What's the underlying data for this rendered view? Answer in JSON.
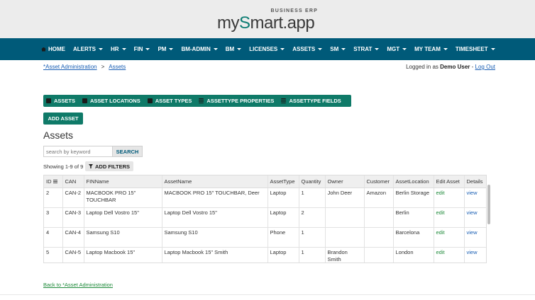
{
  "brand": {
    "main_prefix": "my",
    "main_dot": "S",
    "main_suffix": "mart.app",
    "sub": "BUSINESS ERP"
  },
  "nav": [
    {
      "label": "HOME",
      "has_caret": false
    },
    {
      "label": "ALERTS",
      "has_caret": true
    },
    {
      "label": "HR",
      "has_caret": true
    },
    {
      "label": "FIN",
      "has_caret": true
    },
    {
      "label": "PM",
      "has_caret": true
    },
    {
      "label": "BM-ADMIN",
      "has_caret": true
    },
    {
      "label": "BM",
      "has_caret": true
    },
    {
      "label": "LICENSES",
      "has_caret": true
    },
    {
      "label": "ASSETS",
      "has_caret": true
    },
    {
      "label": "SM",
      "has_caret": true
    },
    {
      "label": "STRAT",
      "has_caret": true
    },
    {
      "label": "MGT",
      "has_caret": true
    },
    {
      "label": "MY TEAM",
      "has_caret": true
    },
    {
      "label": "TIMESHEET",
      "has_caret": true
    }
  ],
  "breadcrumb": {
    "parent": "*Asset Administration",
    "separator": ">",
    "current": "Assets"
  },
  "login": {
    "prefix": "Logged in as",
    "user": "Demo User",
    "dash": "-",
    "logout": "Log Out"
  },
  "tabs": [
    {
      "label": "ASSETS",
      "icon": "car-icon"
    },
    {
      "label": "ASSET LOCATIONS",
      "icon": "building-icon"
    },
    {
      "label": "ASSET TYPES",
      "icon": "tags-icon"
    },
    {
      "label": "ASSETTYPE PROPERTIES",
      "icon": "list-icon"
    },
    {
      "label": "ASSETTYPE FIELDS",
      "icon": "list-icon"
    }
  ],
  "add_button": "ADD ASSET",
  "page_title": "Assets",
  "search": {
    "placeholder": "search by keyword",
    "button": "SEARCH"
  },
  "showing": "Showing 1-9 of 9",
  "filter_button": "ADD FILTERS",
  "table": {
    "columns": [
      "ID",
      "CAN",
      "FINName",
      "AssetName",
      "AssetType",
      "Quantity",
      "Owner",
      "Customer",
      "AssetLocation",
      "Edit Asset",
      "Details"
    ],
    "rows": [
      {
        "id": "2",
        "can": "CAN-2",
        "finname": "MACBOOK PRO 15\" TOUCHBAR",
        "assetname": "MACBOOK PRO 15\" TOUCHBAR, Deer",
        "type": "Laptop",
        "qty": "1",
        "owner": "John Deer",
        "customer": "Amazon",
        "location": "Berlin Storage",
        "edit": "edit",
        "details": "view"
      },
      {
        "id": "3",
        "can": "CAN-3",
        "finname": "Laptop Dell Vostro 15\"",
        "assetname": "Laptop Dell Vostro 15\"",
        "type": "Laptop",
        "qty": "2",
        "owner": "",
        "customer": "",
        "location": "Berlin",
        "edit": "edit",
        "details": "view"
      },
      {
        "id": "4",
        "can": "CAN-4",
        "finname": "Samsung S10",
        "assetname": "Samsung S10",
        "type": "Phone",
        "qty": "1",
        "owner": "",
        "customer": "",
        "location": "Barcelona",
        "edit": "edit",
        "details": "view"
      },
      {
        "id": "5",
        "can": "CAN-5",
        "finname": "Laptop Macbook 15\"",
        "assetname": "Laptop Macbook 15\" Smith",
        "type": "Laptop",
        "qty": "1",
        "owner": "Brandon Smith",
        "customer": "",
        "location": "London",
        "edit": "edit",
        "details": "view"
      }
    ]
  },
  "back_link": "Back to *Asset Administration",
  "colors": {
    "nav_bg": "#005a79",
    "accent_green": "#0f7a68",
    "link_blue": "#1a5fb4",
    "link_green": "#1e8a3a"
  }
}
